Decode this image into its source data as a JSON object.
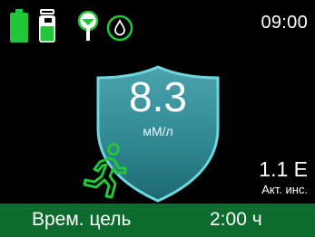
{
  "status": {
    "time": "09:00",
    "icons": [
      "battery-icon",
      "cartridge-icon",
      "sensor-icon",
      "drop-icon"
    ],
    "battery_level": 1.0
  },
  "glucose": {
    "value": "8.3",
    "unit": "мМ/л"
  },
  "insulin": {
    "value": "1.1 Е",
    "label": "Акт. инс."
  },
  "activity": {
    "icon": "running-person-icon"
  },
  "banner": {
    "label": "Врем. цель",
    "time": "2:00 ч"
  },
  "colors": {
    "accent_green": "#22c63a",
    "shield_teal": "#2f8f98",
    "banner_green": "#0e6b2e"
  }
}
